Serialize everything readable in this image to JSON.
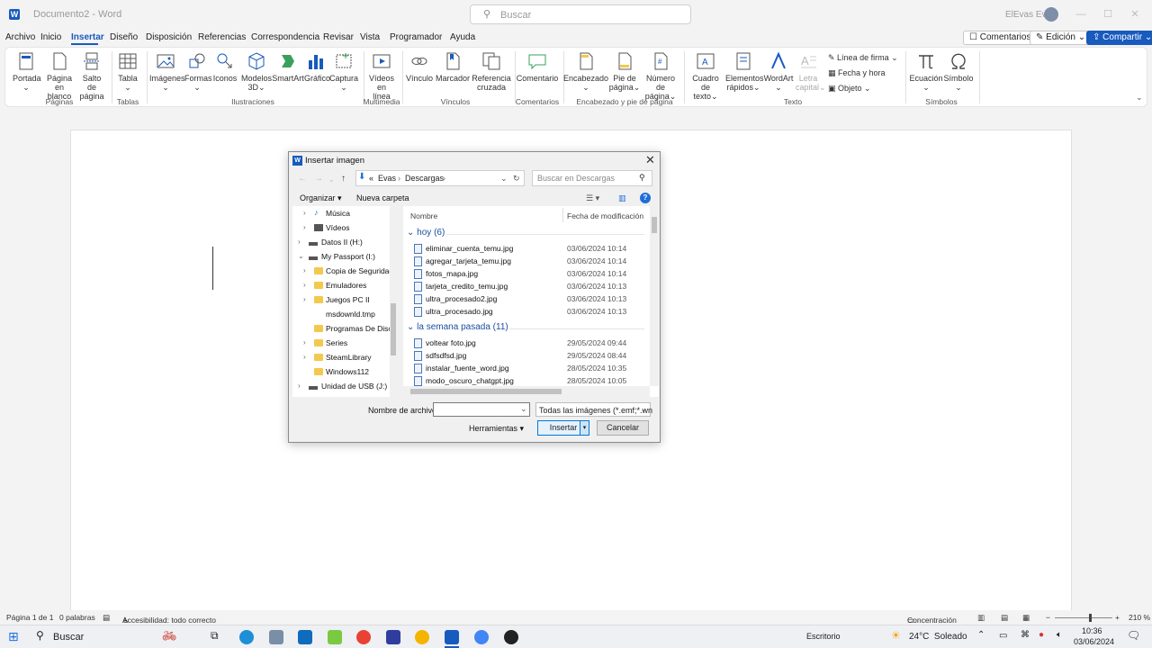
{
  "titlebar": {
    "doc_title": "Documento2 - Word",
    "search_placeholder": "Buscar",
    "user": "ElEvas Evas"
  },
  "menu": {
    "tabs": [
      "Archivo",
      "Inicio",
      "Insertar",
      "Diseño",
      "Disposición",
      "Referencias",
      "Correspondencia",
      "Revisar",
      "Vista",
      "Programador",
      "Ayuda"
    ],
    "active": "Insertar",
    "comments": "Comentarios",
    "editing": "Edición",
    "share": "Compartir"
  },
  "ribbon": {
    "portada": "Portada",
    "pagina_blanco_1": "Página",
    "pagina_blanco_2": "en blanco",
    "salto_1": "Salto de",
    "salto_2": "página",
    "tabla": "Tabla",
    "imagenes": "Imágenes",
    "formas": "Formas",
    "iconos": "Iconos",
    "modelos_1": "Modelos",
    "modelos_2": "3D",
    "smartart": "SmartArt",
    "grafico": "Gráfico",
    "captura": "Captura",
    "videos_1": "Vídeos",
    "videos_2": "en línea",
    "vinculo": "Vínculo",
    "marcador": "Marcador",
    "referencia_1": "Referencia",
    "referencia_2": "cruzada",
    "comentario": "Comentario",
    "encabezado": "Encabezado",
    "pie_1": "Pie de",
    "pie_2": "página",
    "numero_1": "Número de",
    "numero_2": "página",
    "cuadro_1": "Cuadro de",
    "cuadro_2": "texto",
    "elementos_1": "Elementos",
    "elementos_2": "rápidos",
    "wordart": "WordArt",
    "letra_1": "Letra",
    "letra_2": "capital",
    "linea_firma": "Línea de firma",
    "fecha_hora": "Fecha y hora",
    "objeto": "Objeto",
    "ecuacion": "Ecuación",
    "simbolo": "Símbolo",
    "groups": {
      "paginas": "Páginas",
      "tablas": "Tablas",
      "ilustraciones": "Ilustraciones",
      "multimedia": "Multimedia",
      "vinculos": "Vínculos",
      "comentarios": "Comentarios",
      "encabezado": "Encabezado y pie de página",
      "texto": "Texto",
      "simbolos": "Símbolos"
    }
  },
  "dialog": {
    "title": "Insertar imagen",
    "path_prefix": "«",
    "path_1": "Evas",
    "path_2": "Descargas",
    "search_placeholder": "Buscar en Descargas",
    "organize": "Organizar",
    "new_folder": "Nueva carpeta",
    "tree": [
      {
        "label": "Música",
        "type": "music",
        "chev": true
      },
      {
        "label": "Vídeos",
        "type": "video",
        "chev": true
      },
      {
        "label": "Datos II (H:)",
        "type": "drive",
        "chev": true
      },
      {
        "label": "My Passport (I:)",
        "type": "drive",
        "chev": true
      },
      {
        "label": "Copia de Seguridad",
        "type": "folder",
        "chev": true
      },
      {
        "label": "Emuladores",
        "type": "folder",
        "chev": true
      },
      {
        "label": "Juegos PC II",
        "type": "folder",
        "chev": true
      },
      {
        "label": "msdownld.tmp",
        "type": "folder",
        "chev": false
      },
      {
        "label": "Programas De Disco",
        "type": "folder",
        "chev": false
      },
      {
        "label": "Series",
        "type": "folder",
        "chev": true
      },
      {
        "label": "SteamLibrary",
        "type": "folder",
        "chev": true
      },
      {
        "label": "Windows112",
        "type": "folder",
        "chev": false
      },
      {
        "label": "Unidad de USB (J:)",
        "type": "drive",
        "chev": true
      }
    ],
    "col_name": "Nombre",
    "col_date": "Fecha de modificación",
    "group_today": "hoy (6)",
    "group_week": "la semana pasada (11)",
    "files_today": [
      {
        "name": "eliminar_cuenta_temu.jpg",
        "date": "03/06/2024 10:14"
      },
      {
        "name": "agregar_tarjeta_temu.jpg",
        "date": "03/06/2024 10:14"
      },
      {
        "name": "fotos_mapa.jpg",
        "date": "03/06/2024 10:14"
      },
      {
        "name": "tarjeta_credito_temu.jpg",
        "date": "03/06/2024 10:13"
      },
      {
        "name": "ultra_procesado2.jpg",
        "date": "03/06/2024 10:13"
      },
      {
        "name": "ultra_procesado.jpg",
        "date": "03/06/2024 10:13"
      }
    ],
    "files_week": [
      {
        "name": "voltear foto.jpg",
        "date": "29/05/2024 09:44"
      },
      {
        "name": "sdfsdfsd.jpg",
        "date": "29/05/2024 08:44"
      },
      {
        "name": "instalar_fuente_word.jpg",
        "date": "28/05/2024 10:35"
      },
      {
        "name": "modo_oscuro_chatgpt.jpg",
        "date": "28/05/2024 10:05"
      }
    ],
    "filename_label": "Nombre de archivo:",
    "filename_value": "",
    "filter": "Todas las imágenes (*.emf;*.wn",
    "tools": "Herramientas",
    "insert": "Insertar",
    "cancel": "Cancelar"
  },
  "status": {
    "page": "Página 1 de 1",
    "words": "0 palabras",
    "accessibility": "Accesibilidad: todo correcto",
    "focus": "Concentración",
    "zoom": "210 %"
  },
  "taskbar": {
    "search": "Buscar",
    "desktop": "Escritorio",
    "weather": "24°C  Soleado",
    "time": "10:36",
    "date": "03/06/2024"
  }
}
